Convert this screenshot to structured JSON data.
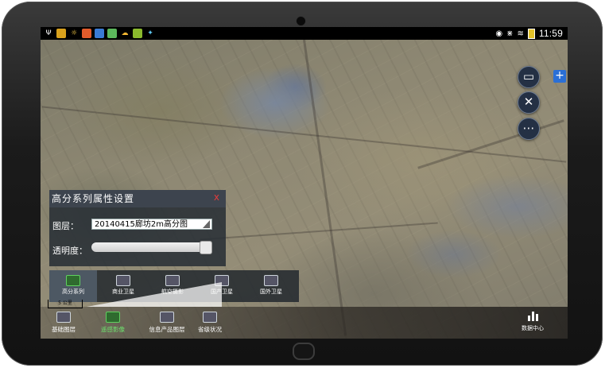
{
  "status_bar": {
    "time": "11:59",
    "left_icons": [
      "usb-icon",
      "app-icon",
      "brightness-icon",
      "app-icon",
      "app-icon",
      "app-icon",
      "cloud-icon",
      "app-icon",
      "app-icon"
    ],
    "right_icons": [
      "eye-icon",
      "mute-icon",
      "wifi-icon",
      "battery-icon"
    ]
  },
  "toolbar": {
    "buttons": [
      "folder-search-icon",
      "tools-icon",
      "chat-icon"
    ],
    "plus_label": "+"
  },
  "properties_panel": {
    "title": "高分系列属性设置",
    "close": "x",
    "layer_label": "图层：",
    "layer_value": "20140415廊坊2m高分图",
    "opacity_label": "透明度：",
    "opacity_value": 0.95
  },
  "sub_tabs": [
    {
      "label": "高分系列",
      "active": true
    },
    {
      "label": "商业卫星",
      "active": false
    },
    {
      "label": "航空摄影",
      "active": false
    },
    {
      "label": "国产卫星",
      "active": false
    },
    {
      "label": "国外卫星",
      "active": false
    }
  ],
  "bottom_tabs": [
    {
      "label": "基础图层",
      "active": false
    },
    {
      "label": "遥感影像",
      "active": true
    },
    {
      "label": "信息产品图层",
      "active": false
    },
    {
      "label": "省级状况",
      "active": false
    }
  ],
  "scale_label": "5 公里",
  "data_center_label": "数据中心",
  "colors": {
    "accent_green": "#6fe36f",
    "close_red": "#e23c3c",
    "plus_blue": "#2a6fd6",
    "panel_bg": "#262d34"
  }
}
